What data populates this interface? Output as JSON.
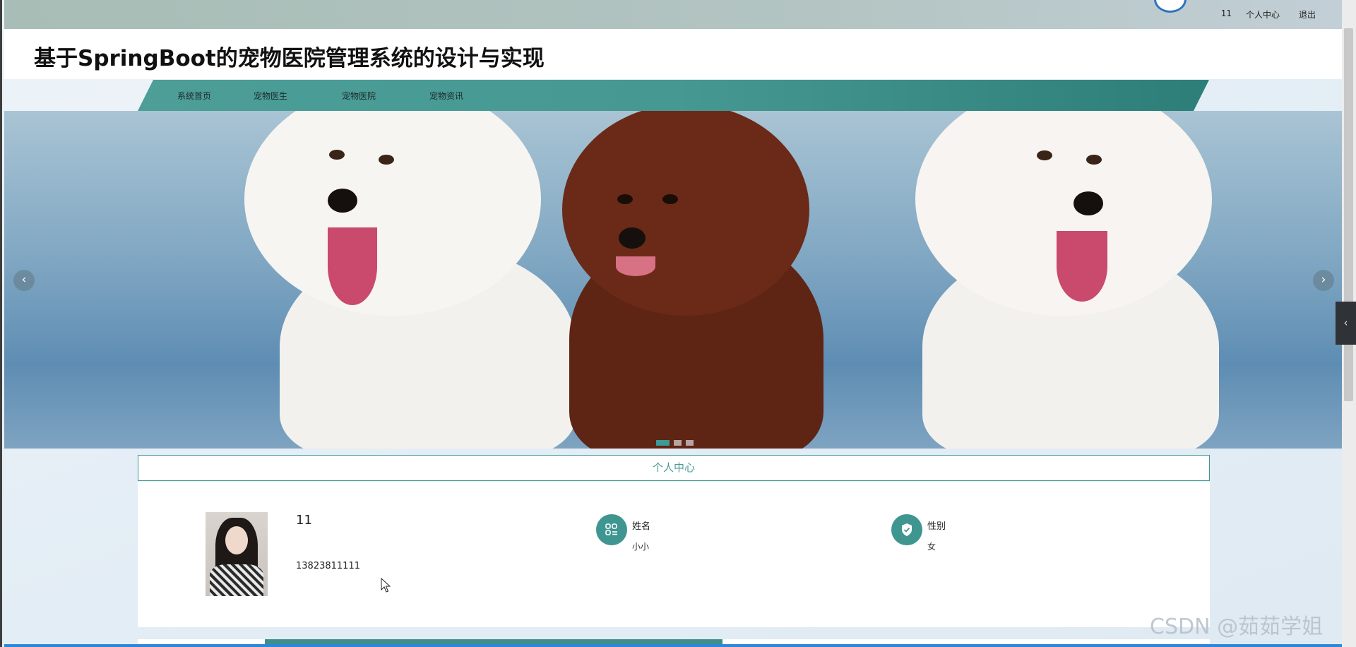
{
  "topbar": {
    "username": "11",
    "personal_center_label": "个人中心",
    "logout_label": "退出"
  },
  "site": {
    "title": "基于SpringBoot的宠物医院管理系统的设计与实现"
  },
  "nav": {
    "items": [
      {
        "label": "系统首页"
      },
      {
        "label": "宠物医生"
      },
      {
        "label": "宠物医院"
      },
      {
        "label": "宠物资讯"
      }
    ]
  },
  "carousel": {
    "prev_icon": "chevron-left-icon",
    "next_icon": "chevron-right-icon",
    "slide_count": 3,
    "active_index": 0
  },
  "profile": {
    "section_title": "个人中心",
    "username": "11",
    "phone": "13823811111",
    "name_label": "姓名",
    "name_value": "小小",
    "gender_label": "性别",
    "gender_value": "女"
  },
  "colors": {
    "accent": "#3f9691",
    "nav": "#469893",
    "topbar": "#adc0bb"
  },
  "watermark": "CSDN @茹茹学姐"
}
